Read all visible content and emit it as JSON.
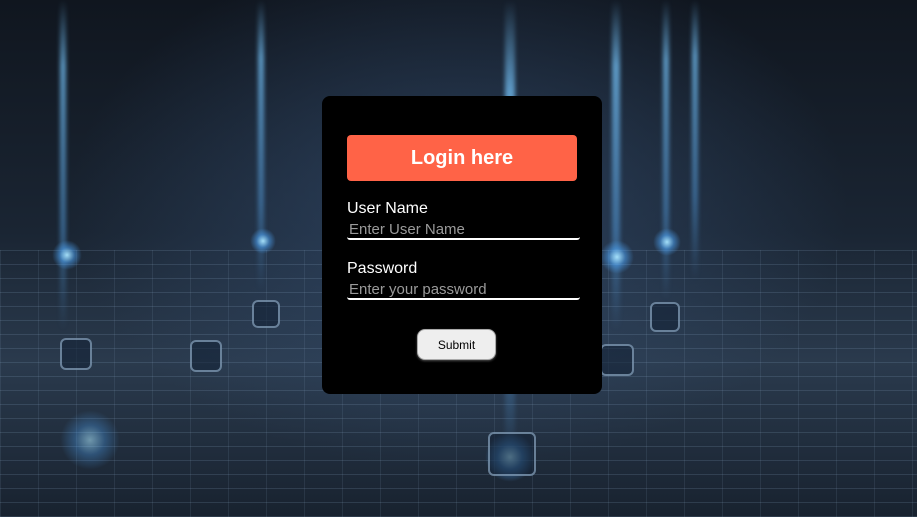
{
  "login": {
    "title": "Login here",
    "username": {
      "label": "User Name",
      "placeholder": "Enter User Name",
      "value": ""
    },
    "password": {
      "label": "Password",
      "placeholder": "Enter your password",
      "value": ""
    },
    "submit_label": "Submit"
  },
  "colors": {
    "accent": "#ff6347",
    "card_background": "#000000",
    "text": "#ffffff"
  }
}
